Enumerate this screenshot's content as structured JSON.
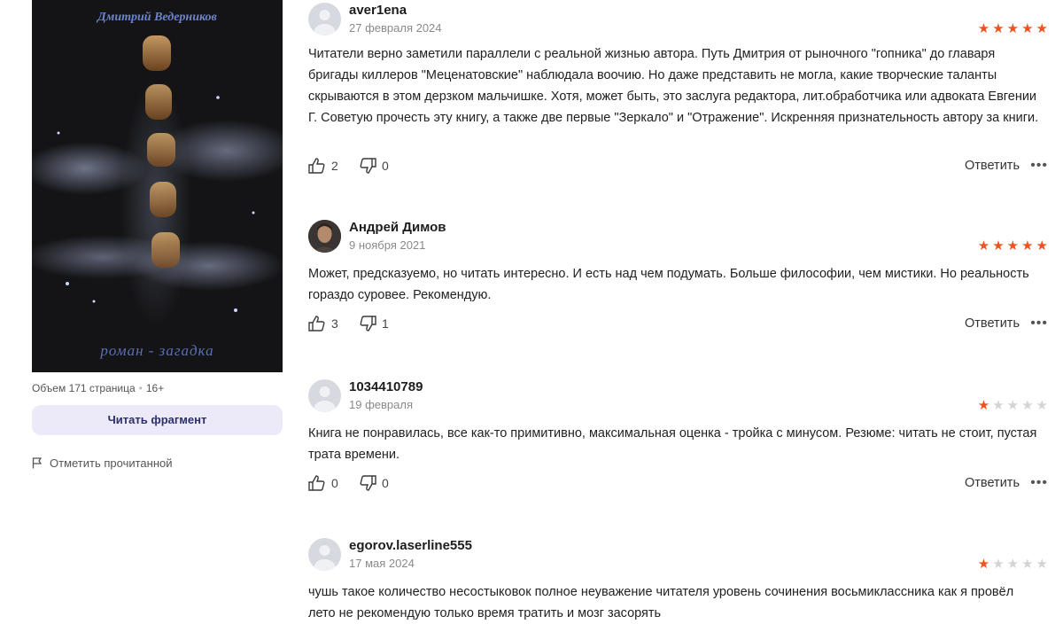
{
  "book": {
    "cover_author": "Дмитрий Ведерников",
    "cover_subtitle": "роман - загадка",
    "pages": "Объем 171 страница",
    "age": "16+",
    "read_button": "Читать фрагмент",
    "mark_read": "Отметить прочитанной"
  },
  "colors": {
    "star_on": "#f0521e",
    "star_off": "#d4d4d8",
    "button_bg": "#eceaf8"
  },
  "reviews": [
    {
      "user": "aver1ena",
      "date": "27 февраля 2024",
      "rating": 5,
      "text": "Читатели верно заметили параллели с реальной жизнью автора. Путь Дмитрия от рыночного \"гопника\" до главаря бригады киллеров \"Меценатовские\" наблюдала воочию. Но даже представить не могла, какие творческие таланты скрываются в этом дерзком мальчишке. Хотя, может быть, это заслуга редактора, лит.обработчика или адвоката Евгении Г. Советую прочесть эту книгу, а также две первые \"Зеркало\" и \"Отражение\". Искренняя признательность автору за книги.",
      "likes": "2",
      "dislikes": "0",
      "reply": "Ответить"
    },
    {
      "user": "Андрей Димов",
      "date": "9 ноября 2021",
      "rating": 5,
      "text": "Может, предсказуемо, но читать интересно. И есть над чем подумать. Больше философии, чем мистики. Но реальность гораздо суровее. Рекомендую.",
      "likes": "3",
      "dislikes": "1",
      "reply": "Ответить"
    },
    {
      "user": "1034410789",
      "date": "19 февраля",
      "rating": 1,
      "text": "Книга не понравилась, все как-то примитивно, максимальная оценка - тройка с минусом. Резюме: читать не стоит, пустая трата времени.",
      "likes": "0",
      "dislikes": "0",
      "reply": "Ответить"
    },
    {
      "user": "egorov.laserline555",
      "date": "17 мая 2024",
      "rating": 1,
      "text": "чушь такое количество несостыковок полное неуважение читателя уровень сочинения восьмиклассника как я провёл лето не рекомендую только время тратить и мозг засорять"
    }
  ]
}
